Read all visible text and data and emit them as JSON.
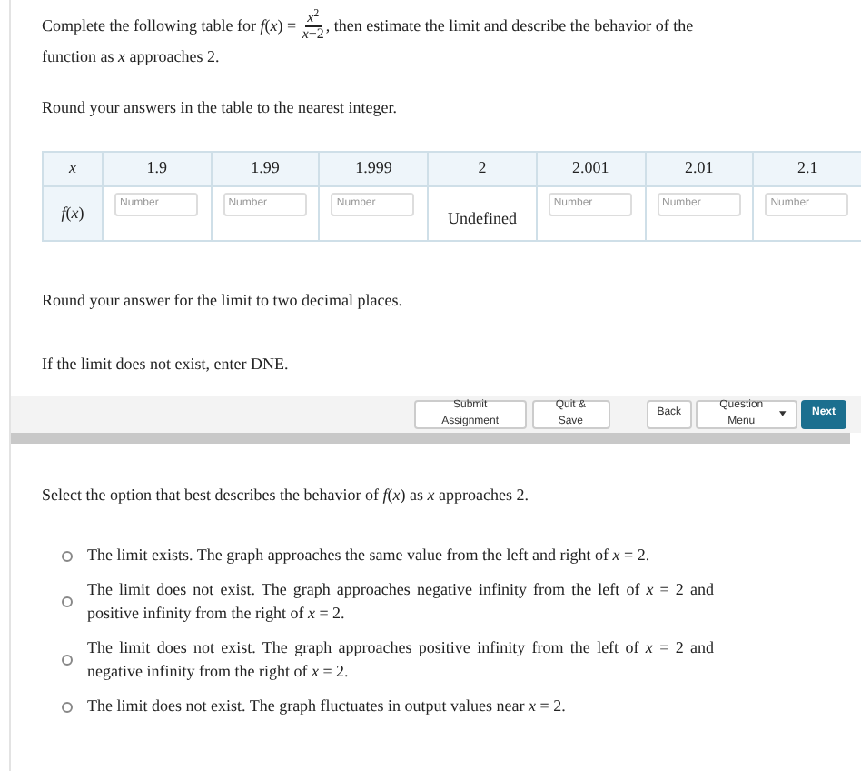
{
  "intro": {
    "before": "Complete the following table for *f*(*x*) = ",
    "numerator": "*x*$^{2}$",
    "denominator": "*x*−2",
    "after": ", then estimate the limit and describe the behavior of the function as *x* approaches 2."
  },
  "table_instruction": "Round your answers in the table to the nearest integer.",
  "table": {
    "header": [
      "*x*",
      "1.9",
      "1.99",
      "1.999",
      "2",
      "2.001",
      "2.01",
      "2.1"
    ],
    "row_label": "*f*(*x*)",
    "cells": [
      {
        "kind": "input",
        "placeholder": "Number"
      },
      {
        "kind": "input",
        "placeholder": "Number"
      },
      {
        "kind": "input",
        "placeholder": "Number"
      },
      {
        "kind": "text",
        "text": "Undefined"
      },
      {
        "kind": "input",
        "placeholder": "Number"
      },
      {
        "kind": "input",
        "placeholder": "Number"
      },
      {
        "kind": "input",
        "placeholder": "Number"
      }
    ]
  },
  "limit_instructions": [
    "Round your answer for the limit to two decimal places.",
    "If the limit does not exist, enter DNE."
  ],
  "toolbar": {
    "left": [
      "Submit Assignment",
      "Quit & Save"
    ],
    "right": [
      {
        "label": "Back",
        "kind": "plain"
      },
      {
        "label": "Question Menu",
        "kind": "menu"
      },
      {
        "label": "Next",
        "kind": "primary"
      }
    ]
  },
  "question": "Select the option that best describes the behavior of *f*(*x*) as *x* approaches 2.",
  "options": [
    {
      "text": "The limit exists. The graph approaches the same value from the left and right of *x* = 2.",
      "selected": false
    },
    {
      "text": "The limit does not exist. The graph approaches negative infinity from the left of *x* = 2 and positive infinity from the right of *x* = 2.",
      "selected": false
    },
    {
      "text": "The limit does not exist. The graph approaches positive infinity from the left of *x* = 2 and negative infinity from the right of *x* = 2.",
      "selected": false
    },
    {
      "text": "The limit does not exist. The graph fluctuates in output values near *x* = 2.",
      "selected": false
    }
  ]
}
